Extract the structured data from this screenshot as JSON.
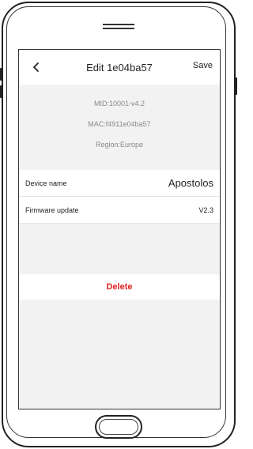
{
  "navbar": {
    "title": "Edit  1e04ba57",
    "save_label": "Save"
  },
  "device_info": {
    "mid": "MID:10001-v4.2",
    "mac": "MAC:f4911e04ba57",
    "region": "Region:Europe"
  },
  "settings": {
    "device_name_label": "Device name",
    "device_name_value": "Apostolos",
    "firmware_label": "Firmware update",
    "firmware_value": "V2.3"
  },
  "actions": {
    "delete_label": "Delete"
  },
  "icons": {
    "back": "chevron-left-icon"
  },
  "colors": {
    "delete": "#e02020",
    "screen_background": "#f2f2f2"
  }
}
